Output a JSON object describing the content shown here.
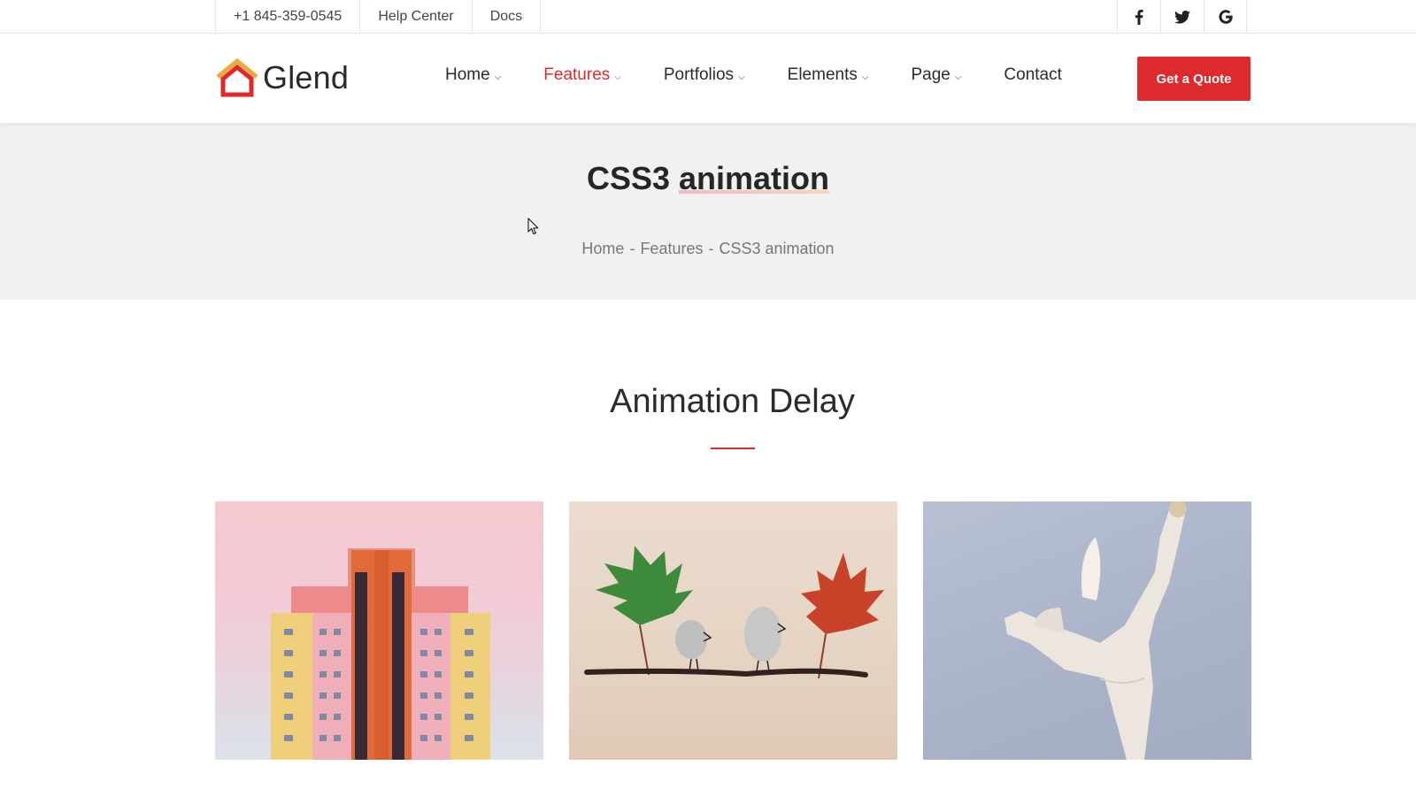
{
  "topbar": {
    "phone": "+1 845-359-0545",
    "help": "Help Center",
    "docs": "Docs",
    "social": [
      {
        "icon": "facebook-icon",
        "glyph": "f"
      },
      {
        "icon": "twitter-icon",
        "glyph": "🐦"
      },
      {
        "icon": "google-icon",
        "glyph": "G"
      }
    ]
  },
  "header": {
    "logo_text": "Glend",
    "nav": [
      {
        "label": "Home",
        "dropdown": true
      },
      {
        "label": "Features",
        "dropdown": true,
        "active": true
      },
      {
        "label": "Portfolios",
        "dropdown": true
      },
      {
        "label": "Elements",
        "dropdown": true
      },
      {
        "label": "Page",
        "dropdown": true
      },
      {
        "label": "Contact",
        "dropdown": false
      }
    ],
    "cta": "Get a Quote"
  },
  "banner": {
    "title_plain": "CSS3",
    "title_highlight": "animation",
    "breadcrumb": [
      "Home",
      "Features",
      "CSS3 animation"
    ],
    "separator": "-"
  },
  "section": {
    "title": "Animation Delay"
  },
  "colors": {
    "accent": "#dd2a2c",
    "banner_bg": "#f1f1f1"
  }
}
